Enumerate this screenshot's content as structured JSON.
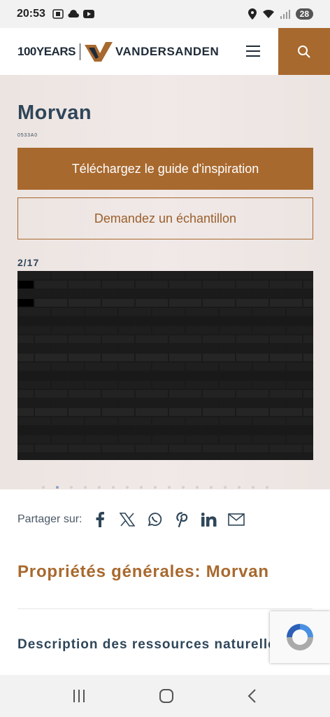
{
  "status_bar": {
    "time": "20:53",
    "battery": "28"
  },
  "header": {
    "years_text": "100YEARS",
    "brand_text": "VANDERSANDEN"
  },
  "product": {
    "title": "Morvan",
    "code": "0533A0",
    "primary_button": "Téléchargez le guide d'inspiration",
    "secondary_button": "Demandez un échantillon",
    "gallery_counter": "2/17"
  },
  "share": {
    "label": "Partager sur:",
    "icons": [
      "facebook-icon",
      "x-icon",
      "whatsapp-icon",
      "pinterest-icon",
      "linkedin-icon",
      "email-icon"
    ]
  },
  "sections": {
    "properties_title": "Propriétés générales: Morvan",
    "description_title": "Description des ressources naturelles"
  },
  "colors": {
    "accent": "#a8692e",
    "heading": "#2f4659",
    "brick": "#1a1a1a"
  }
}
